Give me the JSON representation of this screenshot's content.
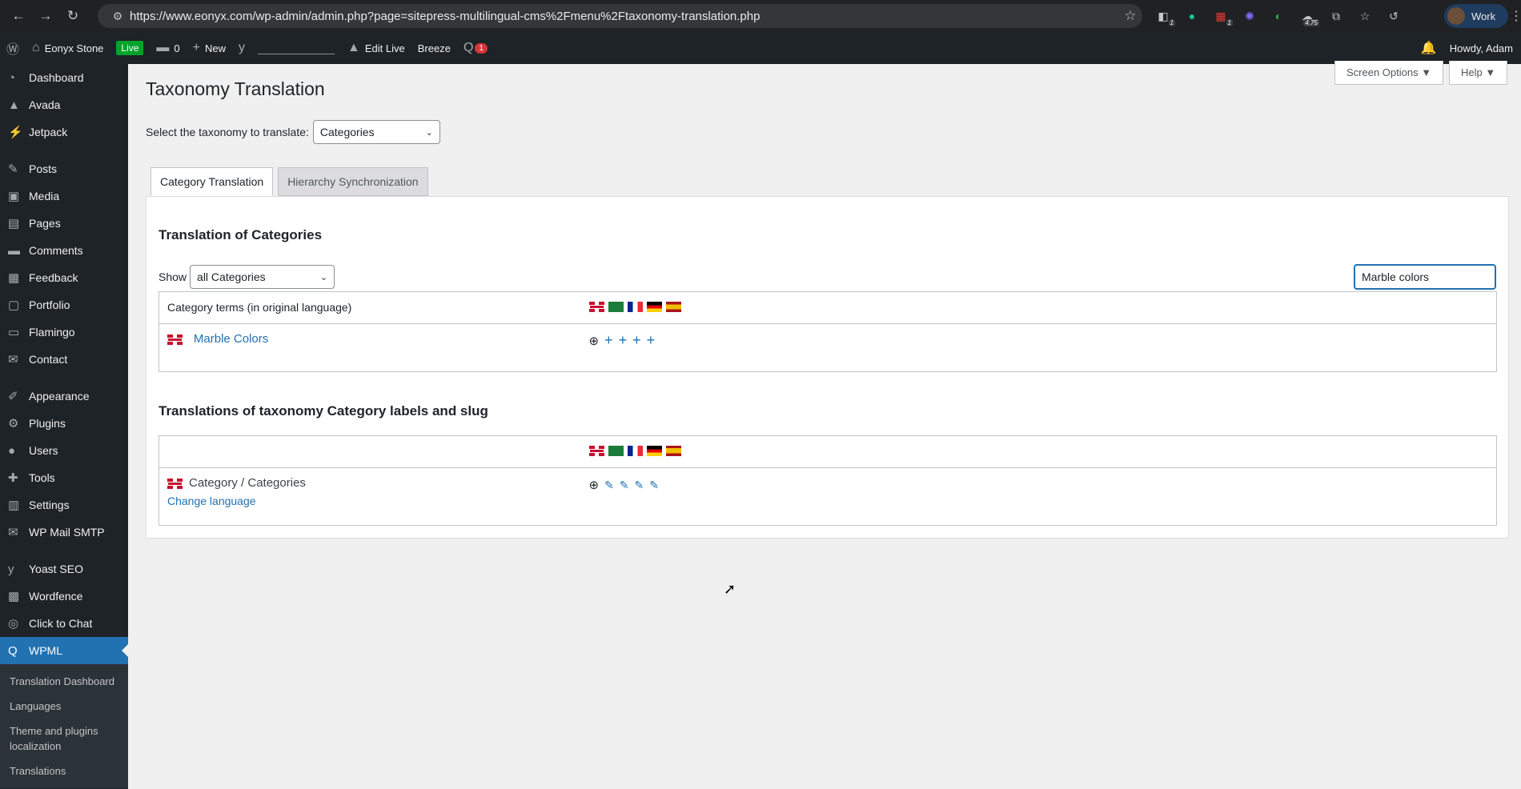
{
  "browser": {
    "url": "https://www.eonyx.com/wp-admin/admin.php?page=sitepress-multilingual-cms%2Fmenu%2Ftaxonomy-translation.php",
    "profile": "Work",
    "ext_badges": [
      "1",
      "1",
      "4.75"
    ]
  },
  "adminbar": {
    "site": "Eonyx Stone",
    "live": "Live",
    "comments": "0",
    "new": "New",
    "edit_live": "Edit Live",
    "breeze": "Breeze",
    "wpml_badge": "1",
    "howdy": "Howdy, Adam"
  },
  "sidebar": {
    "items": [
      {
        "label": "Dashboard",
        "icon": "dashboard-icon"
      },
      {
        "label": "Avada",
        "icon": "avada-icon"
      },
      {
        "label": "Jetpack",
        "icon": "jetpack-icon"
      },
      {
        "label": "Posts",
        "icon": "pin-icon"
      },
      {
        "label": "Media",
        "icon": "media-icon"
      },
      {
        "label": "Pages",
        "icon": "pages-icon"
      },
      {
        "label": "Comments",
        "icon": "comments-icon"
      },
      {
        "label": "Feedback",
        "icon": "feedback-icon"
      },
      {
        "label": "Portfolio",
        "icon": "portfolio-icon"
      },
      {
        "label": "Flamingo",
        "icon": "flamingo-icon"
      },
      {
        "label": "Contact",
        "icon": "mail-icon"
      },
      {
        "label": "Appearance",
        "icon": "brush-icon"
      },
      {
        "label": "Plugins",
        "icon": "plugin-icon"
      },
      {
        "label": "Users",
        "icon": "user-icon"
      },
      {
        "label": "Tools",
        "icon": "wrench-icon"
      },
      {
        "label": "Settings",
        "icon": "settings-icon"
      },
      {
        "label": "WP Mail SMTP",
        "icon": "mail-icon"
      },
      {
        "label": "Yoast SEO",
        "icon": "yoast-icon"
      },
      {
        "label": "Wordfence",
        "icon": "wordfence-icon"
      },
      {
        "label": "Click to Chat",
        "icon": "whatsapp-icon"
      },
      {
        "label": "WPML",
        "icon": "wpml-icon"
      }
    ],
    "submenu": [
      "Translation Dashboard",
      "Languages",
      "Theme and plugins localization",
      "Translations"
    ]
  },
  "screen_options": "Screen Options ▼",
  "help": "Help ▼",
  "page": {
    "title": "Taxonomy Translation",
    "select_label": "Select the taxonomy to translate:",
    "taxonomy": "Categories",
    "tabs": [
      "Category Translation",
      "Hierarchy Synchronization"
    ],
    "section1": "Translation of Categories",
    "show_label": "Show",
    "show_value": "all Categories",
    "search_value": "Marble colors",
    "col_header": "Category terms (in original language)",
    "term": "Marble Colors",
    "section2": "Translations of taxonomy Category labels and slug",
    "label_term": "Category / Categories",
    "change_language": "Change language"
  },
  "colors": {
    "accent": "#2271b1",
    "adminbar": "#1d2327"
  }
}
